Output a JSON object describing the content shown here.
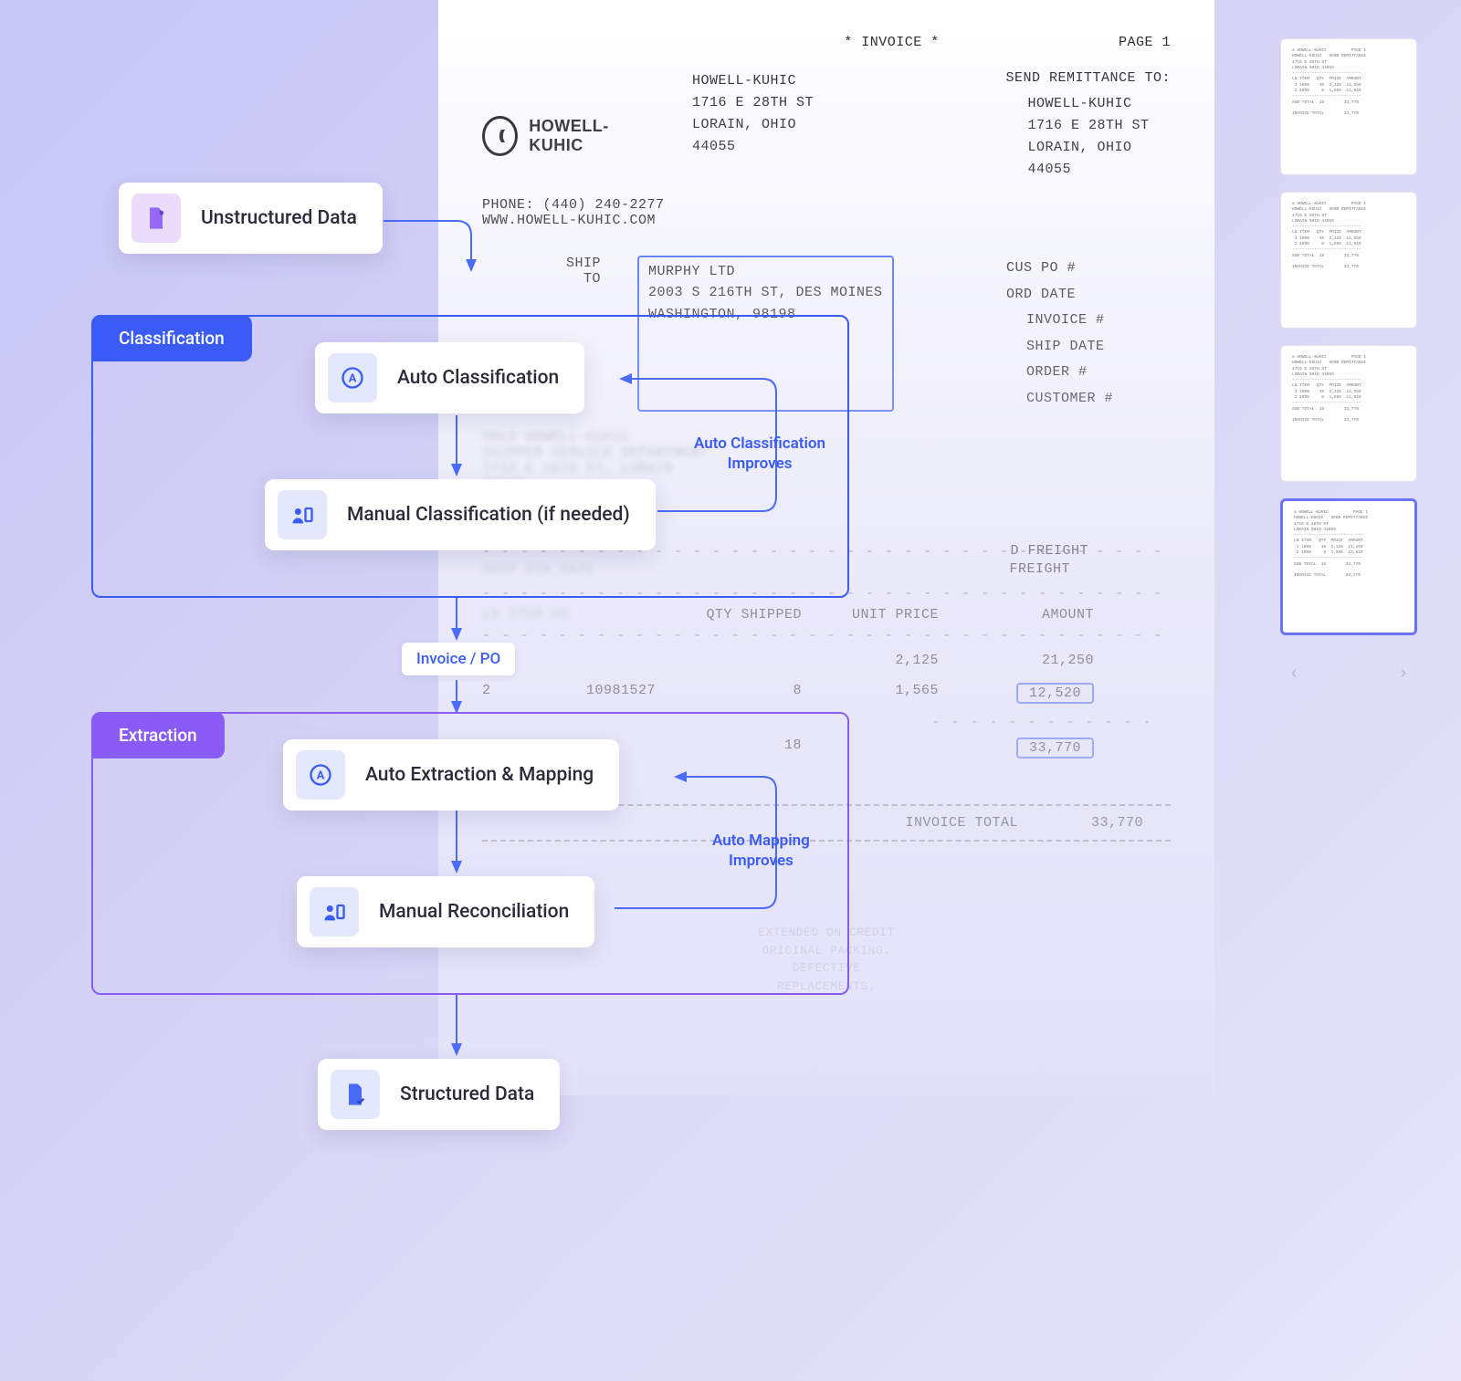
{
  "colors": {
    "blue": "#3a5cf5",
    "purple": "#8a5cf5",
    "highlight": "#4a6cf7"
  },
  "flow": {
    "start_card": "Unstructured Data",
    "classification": {
      "tab": "Classification",
      "auto": "Auto Classification",
      "manual": "Manual Classification (if needed)",
      "feedback": "Auto Classification\nImproves"
    },
    "mid_pill": "Invoice / PO",
    "extraction": {
      "tab": "Extraction",
      "auto": "Auto Extraction & Mapping",
      "manual": "Manual Reconciliation",
      "feedback": "Auto Mapping\nImproves"
    },
    "end_card": "Structured Data"
  },
  "invoice": {
    "doc_title": "* INVOICE *",
    "page_label": "PAGE 1",
    "company_name": "HOWELL-KUHIC",
    "company_address": "HOWELL-KUHIC\n1716 E 28TH ST\nLORAIN, OHIO\n44055",
    "remittance_label": "SEND REMITTANCE TO:",
    "remittance_address": "HOWELL-KUHIC\n1716 E 28TH ST\nLORAIN, OHIO\n44055",
    "phone": "PHONE: (440) 240-2277",
    "website": "WWW.HOWELL-KUHIC.COM",
    "ship_to_label": "SHIP\nTO",
    "ship_to_value": "MURPHY LTD\n2003 S 216TH ST, DES MOINES\nWASHINGTON, 98198",
    "meta_labels": {
      "cus_po": "CUS PO #",
      "ord_date": "ORD DATE",
      "invoice_no": "INVOICE #",
      "ship_date": "SHIP DATE",
      "order_no": "ORDER #",
      "customer_no": "CUSTOMER #"
    },
    "freight1": "D FREIGHT",
    "freight2": "FREIGHT",
    "col_headers": {
      "qty_shipped": "QTY SHIPPED",
      "unit_price": "UNIT PRICE",
      "amount": "AMOUNT"
    },
    "lines": [
      {
        "ln": "",
        "item": "",
        "qty": "",
        "price": "2,125",
        "amount": "21,250",
        "boxed": false
      },
      {
        "ln": "2",
        "item": "10981527",
        "qty": "8",
        "price": "1,565",
        "amount": "12,520",
        "boxed": true
      }
    ],
    "subtotal_label": "SUB TOTAL",
    "subtotal_qty": "18",
    "subtotal_amount": "33,770",
    "invoice_total_label": "INVOICE TOTAL",
    "invoice_total_amount": "33,770",
    "fine_print": "EXTENDED ON CREDIT\nORIGINAL PACKING.\nDEFECTIVE\nREPLACEMENTS."
  },
  "thumbnails": {
    "count": 4,
    "selected_index": 3
  }
}
